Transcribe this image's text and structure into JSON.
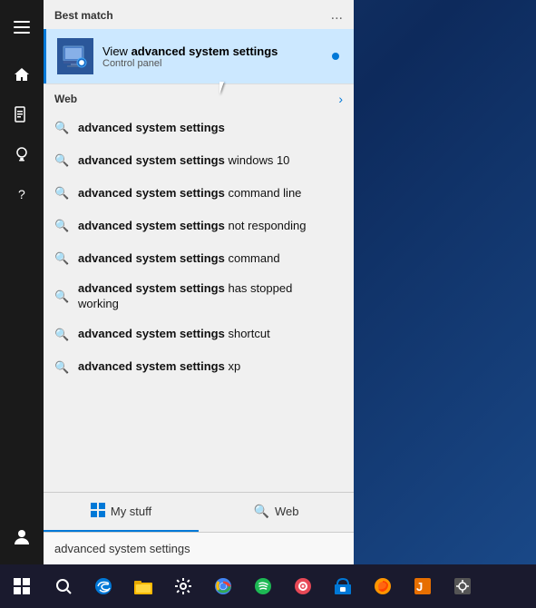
{
  "section": {
    "best_match_label": "Best match",
    "more_options": "...",
    "best_match_item": {
      "title_prefix": "View ",
      "title_bold": "advanced system settings",
      "subtitle": "Control panel"
    },
    "web_label": "Web"
  },
  "suggestions": [
    {
      "bold": "advanced system settings",
      "rest": ""
    },
    {
      "bold": "advanced system settings",
      "rest": " windows 10"
    },
    {
      "bold": "advanced system settings",
      "rest": " command line"
    },
    {
      "bold": "advanced system settings",
      "rest": " not responding"
    },
    {
      "bold": "advanced system settings",
      "rest": " command"
    },
    {
      "bold": "advanced system settings",
      "rest": " has stopped working"
    },
    {
      "bold": "advanced system settings",
      "rest": " shortcut"
    },
    {
      "bold": "advanced system settings",
      "rest": " xp"
    }
  ],
  "tabs": {
    "my_stuff_label": "My stuff",
    "web_label": "Web"
  },
  "search_bar": {
    "value": "advanced system settings"
  },
  "taskbar": {
    "icons": [
      "🌐",
      "📁",
      "⚙️",
      "🌐",
      "🎵",
      "🎯",
      "🛍️",
      "🦊",
      "🐲",
      "⚙️"
    ]
  }
}
